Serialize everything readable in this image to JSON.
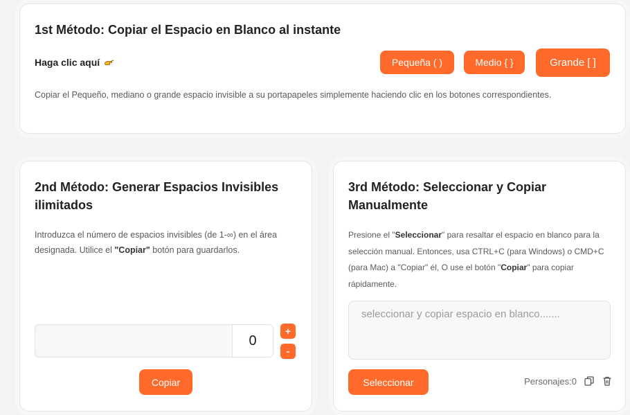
{
  "method1": {
    "title": "1st Método: Copiar el Espacio en Blanco al instante",
    "cta_label": "Haga clic aquí",
    "buttons": {
      "small": "Pequeña ( )",
      "medium": "Medio { }",
      "large": "Grande [ ]"
    },
    "desc": "Copiar el Pequeño, mediano o grande espacio invisible a su portapapeles simplemente haciendo clic en los botones correspondientes."
  },
  "method2": {
    "title": "2nd Método: Generar Espacios Invisibles ilimitados",
    "desc_pre": "Introduzca el número de espacios invisibles (de 1-∞) en el área designada. Utilice el ",
    "desc_bold": "\"Copiar\"",
    "desc_post": " botón para guardarlos.",
    "count": "0",
    "plus": "+",
    "minus": "-",
    "copy_label": "Copiar"
  },
  "method3": {
    "title": "3rd Método: Seleccionar y Copiar Manualmente",
    "desc_p1": "Presione el \"",
    "desc_b1": "Seleccionar",
    "desc_p2": "\" para resaltar el espacio en blanco para la selección manual. Entonces, usa CTRL+C (para Windows) o CMD+C (para Mac) a \"Copiar\" él, O use el botón \"",
    "desc_b2": "Copiar",
    "desc_p3": "\" para copiar rápidamente.",
    "textarea_placeholder": "seleccionar y copiar espacio en blanco.......",
    "select_label": "Seleccionar",
    "chars_label": "Personajes:0"
  },
  "colors": {
    "accent": "#ff6a2b"
  }
}
